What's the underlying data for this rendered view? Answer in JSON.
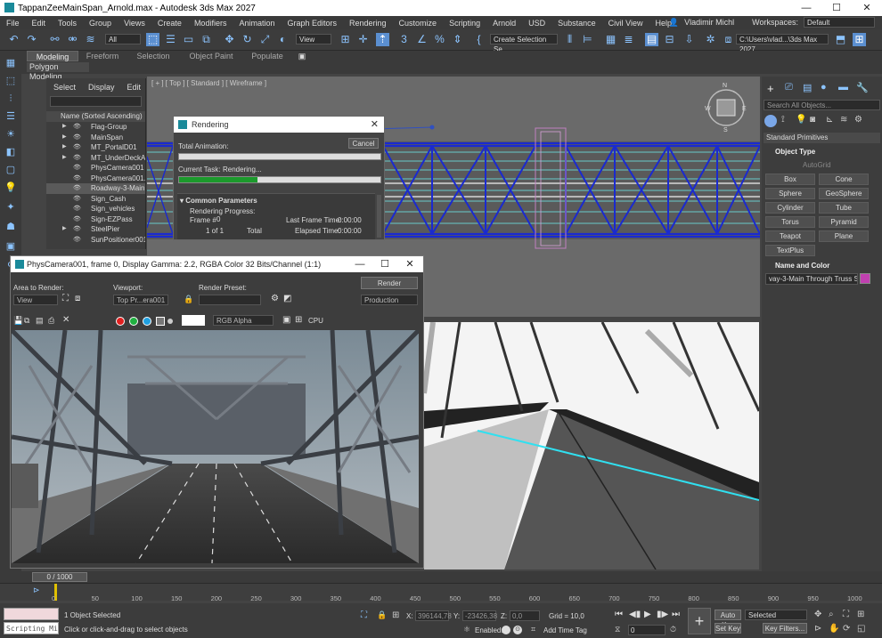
{
  "window": {
    "title": "TappanZeeMainSpan_Arnold.max - Autodesk 3ds Max 2027",
    "buttons": [
      "—",
      "☐",
      "✕"
    ]
  },
  "menu": {
    "items": [
      "File",
      "Edit",
      "Tools",
      "Group",
      "Views",
      "Create",
      "Modifiers",
      "Animation",
      "Graph Editors",
      "Rendering",
      "Customize",
      "Scripting",
      "Arnold",
      "USD",
      "Substance",
      "Civil View",
      "Help"
    ],
    "user": "Vladimir Michl",
    "workspaces_label": "Workspaces:",
    "workspace_value": "Default"
  },
  "toolbar": {
    "filter_value": "All",
    "refcoord_value": "View",
    "selection_set": "Create Selection Se",
    "project_path": "C:\\Users\\vlad...\\3ds Max 2027"
  },
  "ribbon": {
    "tabs": [
      "Modeling",
      "Freeform",
      "Selection",
      "Object Paint",
      "Populate"
    ],
    "active_tab": "Modeling",
    "subtab": "Polygon Modeling"
  },
  "viewport": {
    "label_parts": [
      "[ + ]",
      "[ Top ]",
      "[ Standard ]",
      "[ Wireframe ]"
    ]
  },
  "explorer": {
    "menu": [
      "Select",
      "Display",
      "Edit"
    ],
    "column_header": "Name (Sorted Ascending)",
    "items": [
      {
        "name": "Flag-Group",
        "expand": true
      },
      {
        "name": "MainSpan",
        "expand": true
      },
      {
        "name": "MT_PortalD01",
        "expand": true
      },
      {
        "name": "MT_UnderDeckAsse",
        "expand": true
      },
      {
        "name": "PhysCamera001",
        "expand": false
      },
      {
        "name": "PhysCamera001.Ta",
        "expand": false
      },
      {
        "name": "Roadway-3-Main T",
        "expand": false,
        "selected": true
      },
      {
        "name": "Sign_Cash",
        "expand": false
      },
      {
        "name": "Sign_vehicles",
        "expand": false
      },
      {
        "name": "Sign-EZPass",
        "expand": false
      },
      {
        "name": "SteelPier",
        "expand": true
      },
      {
        "name": "SunPositioner001",
        "expand": false
      }
    ]
  },
  "render_dialog": {
    "title": "Rendering",
    "cancel": "Cancel",
    "total_animation_label": "Total Animation:",
    "total_progress": 0,
    "current_task_label": "Current Task:",
    "current_task_value": "Rendering...",
    "task_progress": 0.39,
    "section": "Common Parameters",
    "rendering_progress_label": "Rendering Progress:",
    "frame_label": "Frame #",
    "frame_value": "0",
    "of_label": "1 of 1",
    "total_label": "Total",
    "last_frame_label": "Last Frame Time:",
    "last_frame_value": "0:00:00",
    "elapsed_label": "Elapsed Time:",
    "elapsed_value": "0:00:00"
  },
  "frame_buffer": {
    "title": "PhysCamera001, frame 0, Display Gamma: 2.2, RGBA Color 32 Bits/Channel (1:1)",
    "area_label": "Area to Render:",
    "area_value": "View",
    "viewport_label": "Viewport:",
    "viewport_value": "Top Pr...era001",
    "preset_label": "Render Preset:",
    "preset_value": "",
    "render_button": "Render",
    "production_value": "Production",
    "channel_value": "RGB Alpha",
    "cpu_label": "CPU"
  },
  "command_panel": {
    "search_placeholder": "Search All Objects...",
    "category": "Standard Primitives",
    "object_type_title": "Object Type",
    "autogrid": "AutoGrid",
    "primitives": [
      "Box",
      "Cone",
      "Sphere",
      "GeoSphere",
      "Cylinder",
      "Tube",
      "Torus",
      "Pyramid",
      "Teapot",
      "Plane",
      "TextPlus"
    ],
    "name_color_title": "Name and Color",
    "object_name": "vay-3-Main Through Truss Span",
    "object_color": "#c040b0"
  },
  "timeline": {
    "slider_label": "0 / 1000",
    "ticks": [
      "0",
      "50",
      "100",
      "150",
      "200",
      "250",
      "300",
      "350",
      "400",
      "450",
      "500",
      "550",
      "600",
      "650",
      "700",
      "750",
      "800",
      "850",
      "900",
      "950",
      "1000"
    ]
  },
  "status": {
    "script_listener": "Scripting Mi",
    "selected_count": "1 Object Selected",
    "prompt": "Click or click-and-drag to select objects",
    "x_label": "X:",
    "x_value": "396144,78",
    "y_label": "Y:",
    "y_value": "-23426,38",
    "z_label": "Z:",
    "z_value": "0,0",
    "grid": "Grid = 10,0",
    "enabled_label": "Enabled:",
    "add_time_tag": "Add Time Tag",
    "frame_field": "0",
    "auto_key": "Auto Key",
    "set_key": "Set Key",
    "key_mode_value": "Selected",
    "key_filters": "Key Filters..."
  }
}
